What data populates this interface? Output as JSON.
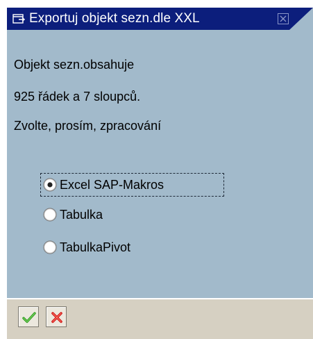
{
  "window": {
    "title": "Exportuj objekt sezn.dle XXL",
    "title_icon": "window-icon",
    "close_icon": "close-icon"
  },
  "message": {
    "line1": "Objekt sezn.obsahuje",
    "line2": "925 řádek a 7 sloupců.",
    "line3": "Zvolte, prosím, zpracování"
  },
  "options": [
    {
      "label": "Excel SAP-Makros",
      "selected": true
    },
    {
      "label": "Tabulka",
      "selected": false
    },
    {
      "label": "TabulkaPivot",
      "selected": false
    }
  ],
  "buttons": {
    "ok_icon": "checkmark-icon",
    "cancel_icon": "cancel-x-icon"
  },
  "colors": {
    "titlebar": "#0c1e7c",
    "dialog_bg": "#a2bacb",
    "button_bar": "#d6d0c2",
    "ok_green": "#2f9a1c",
    "cancel_red": "#d01818"
  }
}
